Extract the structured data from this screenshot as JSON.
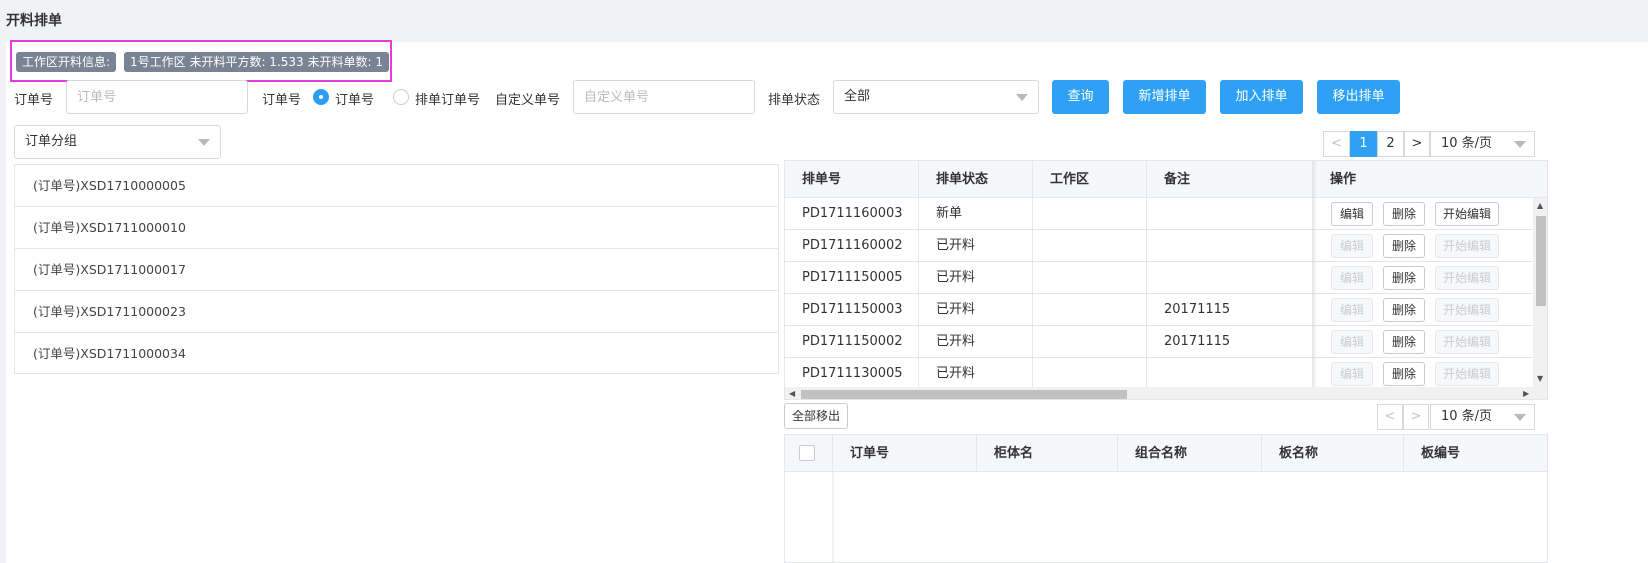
{
  "page": {
    "title": "开料排单"
  },
  "info": {
    "label": "工作区开料信息:",
    "value": "1号工作区 未开料平方数: 1.533 未开料单数: 1"
  },
  "filters": {
    "order_no_label": "订单号",
    "order_no_placeholder": "订单号",
    "radio_group_label": "订单号",
    "radio_options": [
      {
        "label": "订单号",
        "selected": true
      },
      {
        "label": "排单订单号",
        "selected": false
      }
    ],
    "custom_no_label": "自定义单号",
    "custom_no_placeholder": "自定义单号",
    "status_label": "排单状态",
    "status_value": "全部"
  },
  "actions": {
    "query": "查询",
    "new_schedule": "新增排单",
    "add_to_schedule": "加入排单",
    "remove_from_schedule": "移出排单"
  },
  "group_select": {
    "value": "订单分组"
  },
  "order_list": [
    "(订单号)XSD1710000005",
    "(订单号)XSD1711000010",
    "(订单号)XSD1711000017",
    "(订单号)XSD1711000023",
    "(订单号)XSD1711000034"
  ],
  "schedule_pager": {
    "prev": "<",
    "pages": [
      "1",
      "2"
    ],
    "current": "1",
    "next": ">",
    "page_size": "10 条/页"
  },
  "schedule_table": {
    "columns": [
      "排单号",
      "排单状态",
      "工作区",
      "备注",
      "操作"
    ],
    "rows": [
      {
        "no": "PD1711160003",
        "status": "新单",
        "area": "",
        "note": "",
        "editable": true
      },
      {
        "no": "PD1711160002",
        "status": "已开料",
        "area": "",
        "note": "",
        "editable": false
      },
      {
        "no": "PD1711150005",
        "status": "已开料",
        "area": "",
        "note": "",
        "editable": false
      },
      {
        "no": "PD1711150003",
        "status": "已开料",
        "area": "",
        "note": "20171115",
        "editable": false
      },
      {
        "no": "PD1711150002",
        "status": "已开料",
        "area": "",
        "note": "20171115",
        "editable": false
      },
      {
        "no": "PD1711130005",
        "status": "已开料",
        "area": "",
        "note": "",
        "editable": false
      }
    ],
    "op_labels": {
      "edit": "编辑",
      "delete": "删除",
      "start_edit": "开始编辑"
    }
  },
  "detail": {
    "remove_all": "全部移出",
    "pager": {
      "prev": "<",
      "next": ">",
      "page_size": "10 条/页"
    },
    "columns": [
      "订单号",
      "柜体名",
      "组合名称",
      "板名称",
      "板编号"
    ]
  }
}
